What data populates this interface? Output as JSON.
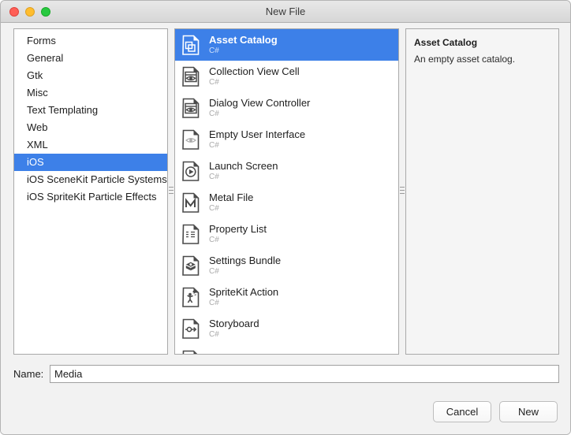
{
  "window": {
    "title": "New File",
    "traffic_lights": [
      {
        "name": "close-button",
        "color": "#ff5f57"
      },
      {
        "name": "minimize-button",
        "color": "#ffbd2e"
      },
      {
        "name": "maximize-button",
        "color": "#28c940"
      }
    ]
  },
  "categories": {
    "items": [
      {
        "label": "Forms",
        "selected": false
      },
      {
        "label": "General",
        "selected": false
      },
      {
        "label": "Gtk",
        "selected": false
      },
      {
        "label": "Misc",
        "selected": false
      },
      {
        "label": "Text Templating",
        "selected": false
      },
      {
        "label": "Web",
        "selected": false
      },
      {
        "label": "XML",
        "selected": false
      },
      {
        "label": "iOS",
        "selected": true
      },
      {
        "label": "iOS SceneKit Particle Systems",
        "selected": false
      },
      {
        "label": "iOS SpriteKit Particle Effects",
        "selected": false
      }
    ],
    "selected_color": "#3d80e8"
  },
  "templates": {
    "items": [
      {
        "label": "Asset Catalog",
        "language": "C#",
        "icon": "asset-catalog-icon",
        "selected": true
      },
      {
        "label": "Collection View Cell",
        "language": "C#",
        "icon": "collection-view-cell-icon",
        "selected": false
      },
      {
        "label": "Dialog View Controller",
        "language": "C#",
        "icon": "dialog-view-controller-icon",
        "selected": false
      },
      {
        "label": "Empty User Interface",
        "language": "C#",
        "icon": "empty-user-interface-icon",
        "selected": false
      },
      {
        "label": "Launch Screen",
        "language": "C#",
        "icon": "launch-screen-icon",
        "selected": false
      },
      {
        "label": "Metal File",
        "language": "C#",
        "icon": "metal-file-icon",
        "selected": false
      },
      {
        "label": "Property List",
        "language": "C#",
        "icon": "property-list-icon",
        "selected": false
      },
      {
        "label": "Settings Bundle",
        "language": "C#",
        "icon": "settings-bundle-icon",
        "selected": false
      },
      {
        "label": "SpriteKit Action",
        "language": "C#",
        "icon": "spritekit-action-icon",
        "selected": false
      },
      {
        "label": "Storyboard",
        "language": "C#",
        "icon": "storyboard-icon",
        "selected": false
      },
      {
        "label": "",
        "language": "",
        "icon": "document-icon",
        "selected": false
      }
    ]
  },
  "details": {
    "title": "Asset Catalog",
    "description": "An empty asset catalog."
  },
  "name_field": {
    "label": "Name:",
    "value": "Media",
    "placeholder": ""
  },
  "footer": {
    "cancel_label": "Cancel",
    "new_label": "New"
  }
}
